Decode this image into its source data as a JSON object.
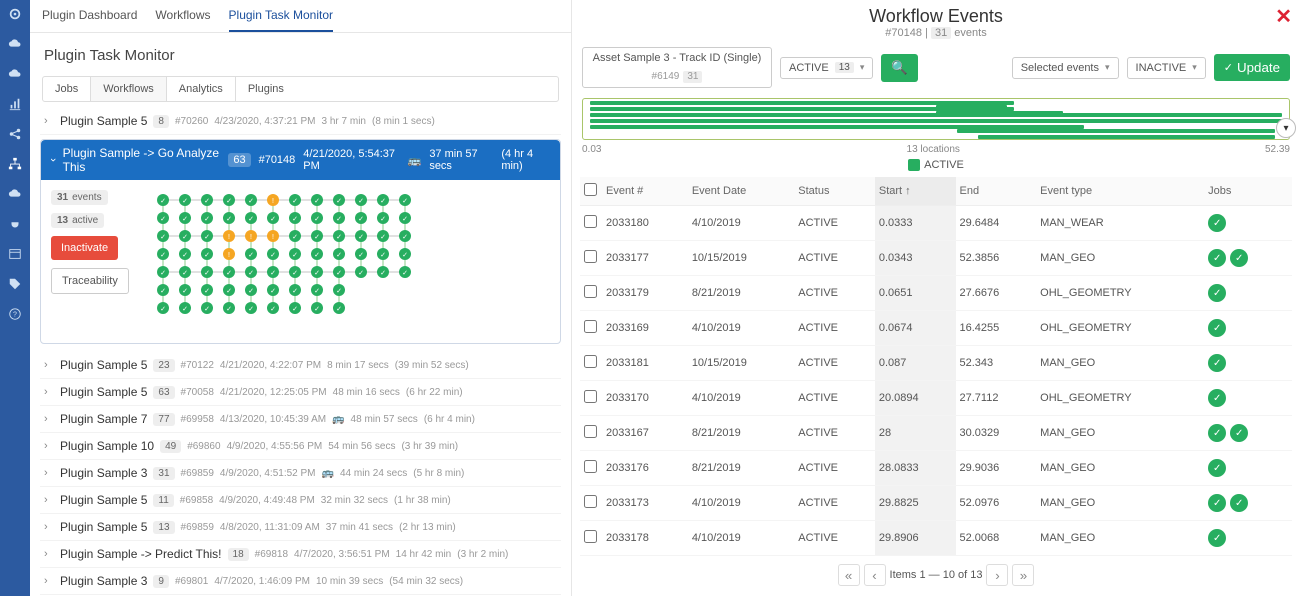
{
  "nav_tabs": [
    "Plugin Dashboard",
    "Workflows",
    "Plugin Task Monitor"
  ],
  "active_nav_tab": 2,
  "page_title": "Plugin Task Monitor",
  "sub_tabs": [
    "Jobs",
    "Workflows",
    "Analytics",
    "Plugins"
  ],
  "active_sub_tab": 1,
  "workflows_top": {
    "name": "Plugin Sample 5",
    "count": "8",
    "id": "#70260",
    "ts": "4/23/2020, 4:37:21 PM",
    "dur": "3 hr 7 min",
    "paren": "(8 min 1 secs)"
  },
  "expanded": {
    "name": "Plugin Sample -> Go Analyze This",
    "count": "63",
    "id": "#70148",
    "ts": "4/21/2020, 5:54:37 PM",
    "dur": "37 min 57 secs",
    "paren": "(4 hr 4 min)",
    "events_count": "31",
    "events_label": "events",
    "active_count": "13",
    "active_label": "active",
    "btn_inactivate": "Inactivate",
    "btn_traceability": "Traceability"
  },
  "workflows_rest": [
    {
      "name": "Plugin Sample 5",
      "count": "23",
      "id": "#70122",
      "ts": "4/21/2020, 4:22:07 PM",
      "dur": "8 min 17 secs",
      "paren": "(39 min 52 secs)",
      "bus": false
    },
    {
      "name": "Plugin Sample 5",
      "count": "63",
      "id": "#70058",
      "ts": "4/21/2020, 12:25:05 PM",
      "dur": "48 min 16 secs",
      "paren": "(6 hr 22 min)",
      "bus": false
    },
    {
      "name": "Plugin Sample 7",
      "count": "77",
      "id": "#69958",
      "ts": "4/13/2020, 10:45:39 AM",
      "dur": "48 min 57 secs",
      "paren": "(6 hr 4 min)",
      "bus": true
    },
    {
      "name": "Plugin Sample 10",
      "count": "49",
      "id": "#69860",
      "ts": "4/9/2020, 4:55:56 PM",
      "dur": "54 min 56 secs",
      "paren": "(3 hr 39 min)",
      "bus": false
    },
    {
      "name": "Plugin Sample 3",
      "count": "31",
      "id": "#69859",
      "ts": "4/9/2020, 4:51:52 PM",
      "dur": "44 min 24 secs",
      "paren": "(5 hr 8 min)",
      "bus": true
    },
    {
      "name": "Plugin Sample 5",
      "count": "11",
      "id": "#69858",
      "ts": "4/9/2020, 4:49:48 PM",
      "dur": "32 min 32 secs",
      "paren": "(1 hr 38 min)",
      "bus": false
    },
    {
      "name": "Plugin Sample 5",
      "count": "13",
      "id": "#69859",
      "ts": "4/8/2020, 11:31:09 AM",
      "dur": "37 min 41 secs",
      "paren": "(2 hr 13 min)",
      "bus": false
    },
    {
      "name": "Plugin Sample -> Predict This!",
      "count": "18",
      "id": "#69818",
      "ts": "4/7/2020, 3:56:51 PM",
      "dur": "14 hr 42 min",
      "paren": "(3 hr 2 min)",
      "bus": false
    },
    {
      "name": "Plugin Sample 3",
      "count": "9",
      "id": "#69801",
      "ts": "4/7/2020, 1:46:09 PM",
      "dur": "10 min 39 secs",
      "paren": "(54 min 32 secs)",
      "bus": false
    }
  ],
  "right": {
    "title": "Workflow Events",
    "sub_id": "#70148",
    "sub_count": "31",
    "sub_label": "events",
    "asset": {
      "name": "Asset Sample 3 - Track ID (Single)",
      "id": "#6149",
      "badge": "31"
    },
    "status_filter": {
      "label": "ACTIVE",
      "badge": "13"
    },
    "selected_events_label": "Selected events",
    "inactive_label": "INACTIVE",
    "update_label": "Update",
    "timeline": {
      "left": "0.03",
      "center": "13 locations",
      "right": "52.39",
      "legend": "ACTIVE"
    },
    "columns": [
      "",
      "Event #",
      "Event Date",
      "Status",
      "Start ↑",
      "End",
      "Event type",
      "Jobs"
    ],
    "rows": [
      {
        "evt": "2033180",
        "date": "4/10/2019",
        "status": "ACTIVE",
        "start": "0.0333",
        "end": "29.6484",
        "type": "MAN_WEAR",
        "jobs": 1
      },
      {
        "evt": "2033177",
        "date": "10/15/2019",
        "status": "ACTIVE",
        "start": "0.0343",
        "end": "52.3856",
        "type": "MAN_GEO",
        "jobs": 2
      },
      {
        "evt": "2033179",
        "date": "8/21/2019",
        "status": "ACTIVE",
        "start": "0.0651",
        "end": "27.6676",
        "type": "OHL_GEOMETRY",
        "jobs": 1
      },
      {
        "evt": "2033169",
        "date": "4/10/2019",
        "status": "ACTIVE",
        "start": "0.0674",
        "end": "16.4255",
        "type": "OHL_GEOMETRY",
        "jobs": 1
      },
      {
        "evt": "2033181",
        "date": "10/15/2019",
        "status": "ACTIVE",
        "start": "0.087",
        "end": "52.343",
        "type": "MAN_GEO",
        "jobs": 1
      },
      {
        "evt": "2033170",
        "date": "4/10/2019",
        "status": "ACTIVE",
        "start": "20.0894",
        "end": "27.7112",
        "type": "OHL_GEOMETRY",
        "jobs": 1
      },
      {
        "evt": "2033167",
        "date": "8/21/2019",
        "status": "ACTIVE",
        "start": "28",
        "end": "30.0329",
        "type": "MAN_GEO",
        "jobs": 2
      },
      {
        "evt": "2033176",
        "date": "8/21/2019",
        "status": "ACTIVE",
        "start": "28.0833",
        "end": "29.9036",
        "type": "MAN_GEO",
        "jobs": 1
      },
      {
        "evt": "2033173",
        "date": "4/10/2019",
        "status": "ACTIVE",
        "start": "29.8825",
        "end": "52.0976",
        "type": "MAN_GEO",
        "jobs": 2
      },
      {
        "evt": "2033178",
        "date": "4/10/2019",
        "status": "ACTIVE",
        "start": "29.8906",
        "end": "52.0068",
        "type": "MAN_GEO",
        "jobs": 1
      }
    ],
    "pager_text": "Items 1 — 10 of 13"
  }
}
